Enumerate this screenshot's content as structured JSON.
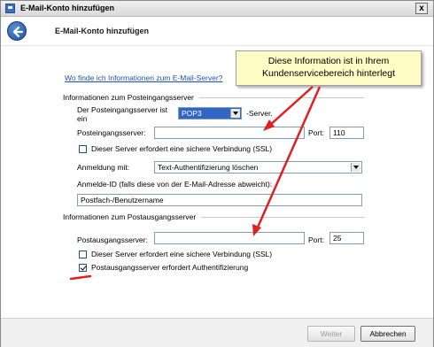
{
  "window": {
    "title": "E-Mail-Konto hinzufügen",
    "close_label": "x",
    "icon": "mail-app-icon"
  },
  "header": {
    "title": "E-Mail-Konto hinzufügen",
    "back_icon": "back-arrow-icon"
  },
  "tooltip": {
    "line1": "Diese Information ist in Ihrem",
    "line2": "Kundenservicebereich hinterlegt"
  },
  "link_text": "Wo finde ich Informationen zum E-Mail-Server?",
  "incoming": {
    "section_title": "Informationen zum Posteingangsserver",
    "server_type_label_line1": "Der Posteingangsserver ist",
    "server_type_label_line2": "ein",
    "server_type_value": "POP3",
    "server_suffix": "-Server.",
    "server_label": "Posteingangsserver:",
    "server_value": "",
    "port_label": "Port:",
    "port_value": "110",
    "ssl_label": "Dieser Server erfordert eine sichere Verbindung (SSL)",
    "ssl_checked": false,
    "login_label": "Anmeldung mit:",
    "login_value": "Text-Authentifizierung löschen",
    "login_id_label": "Anmelde-ID (falls diese von der E-Mail-Adresse abweicht):",
    "login_id_value": "Postfach-/Benutzername"
  },
  "outgoing": {
    "section_title": "Informationen zum Postausgangsserver",
    "server_label": "Postausgangsserver:",
    "server_value": "",
    "port_label": "Port:",
    "port_value": "25",
    "ssl_label": "Dieser Server erfordert eine sichere Verbindung (SSL)",
    "ssl_checked": false,
    "auth_label": "Postausgangsserver erfordert Authentifizierung",
    "auth_checked": true
  },
  "footer": {
    "next_label": "Weiter",
    "cancel_label": "Abbrechen"
  },
  "colors": {
    "annotation_red": "#e02020",
    "tooltip_bg": "#fffbc4",
    "select_highlight": "#3166c5"
  }
}
